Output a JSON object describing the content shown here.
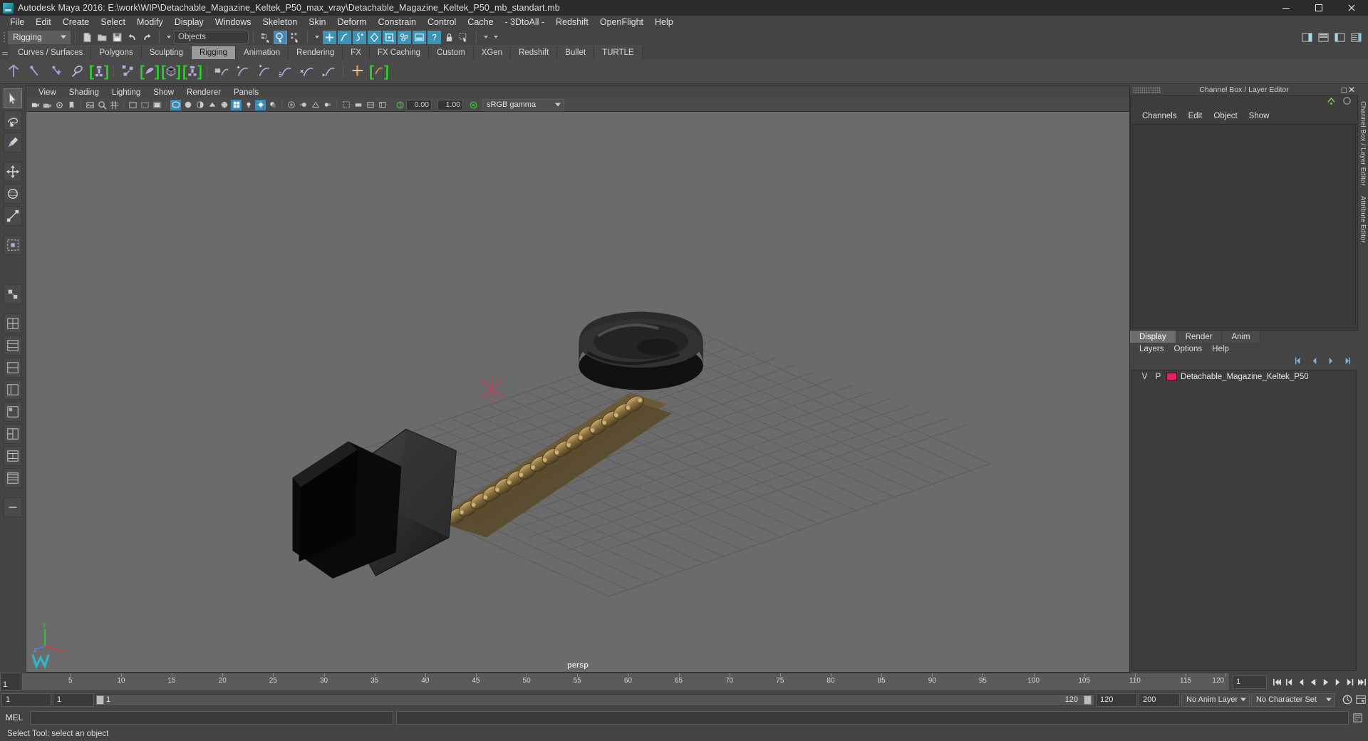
{
  "window": {
    "title": "Autodesk Maya 2016: E:\\work\\WIP\\Detachable_Magazine_Keltek_P50_max_vray\\Detachable_Magazine_Keltek_P50_mb_standart.mb",
    "app_icon": "maya-logo-icon",
    "controls": {
      "minimize": "minimize-icon",
      "maximize": "maximize-icon",
      "close": "close-icon"
    }
  },
  "menubar": {
    "items": [
      "File",
      "Edit",
      "Create",
      "Select",
      "Modify",
      "Display",
      "Windows",
      "Skeleton",
      "Skin",
      "Deform",
      "Constrain",
      "Control",
      "Cache",
      "- 3DtoAll -",
      "Redshift",
      "OpenFlight",
      "Help"
    ]
  },
  "statusline": {
    "menuset": "Rigging",
    "object_field": "Objects",
    "object_placeholder": "Objects",
    "icons": [
      "new-scene-icon",
      "open-scene-icon",
      "save-scene-icon",
      "undo-icon",
      "redo-icon",
      "select-hierarchy-icon",
      "select-object-icon",
      "select-component-icon",
      "snap-grid-icon",
      "snap-curve-icon",
      "snap-point-icon",
      "snap-projected-icon",
      "snap-viewplane-icon",
      "make-live-icon",
      "render-view-icon",
      "help-icon",
      "lock-icon",
      "selection-mask-icon"
    ],
    "right_icons": [
      "sidebar-toggle-icon",
      "attribute-editor-icon",
      "tool-settings-icon",
      "channel-box-icon"
    ]
  },
  "shelf": {
    "tabs": [
      "Curves / Surfaces",
      "Polygons",
      "Sculpting",
      "Rigging",
      "Animation",
      "Rendering",
      "FX",
      "FX Caching",
      "Custom",
      "XGen",
      "Redshift",
      "Bullet",
      "TURTLE"
    ],
    "active_tab": "Rigging",
    "icons": [
      "create-joint-icon",
      "ik-handle-icon",
      "ik-spline-handle-icon",
      "insert-joint-icon",
      "skeleton-tool-icon",
      "bind-skin-icon",
      "smooth-bind-icon",
      "lattice-icon",
      "cluster-icon",
      "blendshape-icon",
      "wire-tool-icon",
      "wrap-icon",
      "sculpt-deformer-icon",
      "jiggle-icon",
      "nonlinear-bend-icon",
      "constrain-parent-icon",
      "constrain-point-icon"
    ]
  },
  "toolbox": {
    "tools": [
      "select-tool-icon",
      "lasso-select-tool-icon",
      "paint-select-tool-icon",
      "move-tool-icon",
      "rotate-tool-icon",
      "scale-tool-icon",
      "soft-mod-tool-icon",
      "show-manipulator-tool-icon",
      "last-tool-icon",
      "single-perspective-layout-icon",
      "four-view-layout-icon",
      "persp-outliner-layout-icon",
      "persp-graph-layout-icon",
      "hypershade-layout-icon",
      "persp-hypergraph-layout-icon",
      "two-pane-layout-icon",
      "three-pane-layout-icon",
      "custom-layout-icon"
    ],
    "selected": "select-tool-icon"
  },
  "viewport": {
    "menu": [
      "View",
      "Shading",
      "Lighting",
      "Show",
      "Renderer",
      "Panels"
    ],
    "camera_label": "persp",
    "exposure": "0.00",
    "gamma": "1.00",
    "color_profile": "sRGB gamma",
    "toolbar_icons": [
      "select-camera-icon",
      "lock-camera-icon",
      "camera-attributes-icon",
      "bookmark-icon",
      "image-plane-icon",
      "two-d-pan-zoom-icon",
      "grid-toggle-icon",
      "film-gate-icon",
      "resolution-gate-icon",
      "gate-mask-icon",
      "xray-toggle-icon",
      "xray-joints-icon",
      "wireframe-shading-icon",
      "smooth-shade-all-icon",
      "smooth-shade-selected-icon",
      "flat-shade-icon",
      "shaded-wireframe-icon",
      "textured-icon",
      "use-default-lighting-icon",
      "use-all-lights-icon",
      "shadows-icon",
      "screen-space-ao-icon",
      "motion-blur-icon",
      "multisample-aa-icon",
      "depth-of-field-icon",
      "isolate-select-icon",
      "grid-display-icon",
      "xray-display-icon",
      "exposure-icon",
      "gamma-icon",
      "color-management-icon"
    ]
  },
  "channelbox": {
    "dock_title": "Channel Box / Layer Editor",
    "tabs": [
      "Channels",
      "Edit",
      "Object",
      "Show"
    ],
    "header_icons": [
      "channel-box-icon",
      "attribute-editor-toggle-icon"
    ]
  },
  "layer_editor": {
    "tabs": [
      "Display",
      "Render",
      "Anim"
    ],
    "active_tab": "Display",
    "menu": [
      "Layers",
      "Options",
      "Help"
    ],
    "buttons": [
      "layer-prev-icon",
      "layer-play-prev-icon",
      "layer-play-next-icon",
      "layer-next-icon"
    ],
    "columns": [
      "V",
      "P",
      "color",
      "name"
    ],
    "rows": [
      {
        "visible": "V",
        "playback": "P",
        "color": "#e0245e",
        "name": "Detachable_Magazine_Keltek_P50"
      }
    ]
  },
  "vertical_tabs": [
    "Channel Box / Layer Editor",
    "Attribute Editor"
  ],
  "timeline": {
    "start_display": "1",
    "current_frame": "1",
    "ticks": [
      5,
      10,
      15,
      20,
      25,
      30,
      35,
      40,
      45,
      50,
      55,
      60,
      65,
      70,
      75,
      80,
      85,
      90,
      95,
      100,
      105,
      110,
      115,
      120
    ],
    "frame_field": "1",
    "playback_buttons": [
      "go-to-start-icon",
      "step-back-key-icon",
      "step-back-frame-icon",
      "play-backwards-icon",
      "play-forwards-icon",
      "step-forward-frame-icon",
      "step-forward-key-icon",
      "go-to-end-icon"
    ]
  },
  "range_slider": {
    "range_start": "1",
    "anim_start": "1",
    "slider_start_label": "1",
    "slider_end_label": "120",
    "anim_end": "120",
    "range_end": "200",
    "anim_layer": "No Anim Layer",
    "character_set": "No Character Set",
    "auto_key_icon": "auto-keyframe-icon",
    "prefs_icon": "animation-preferences-icon"
  },
  "command_line": {
    "label": "MEL",
    "input_value": "",
    "output_value": ""
  },
  "help_line": {
    "text": "Select Tool: select an object"
  },
  "colors": {
    "accent_blue": "#4c88b3",
    "shelf_green": "#2ecc2e",
    "layer_swatch": "#e0245e",
    "panel_bg": "#444444",
    "viewport_bg": "#6b6b6b",
    "titlebar_bg": "#2b2b2b"
  },
  "scene": {
    "grid": true,
    "objects": [
      "magazine-body",
      "magazine-baseplate",
      "bullet-row",
      "magazine-cap"
    ]
  }
}
